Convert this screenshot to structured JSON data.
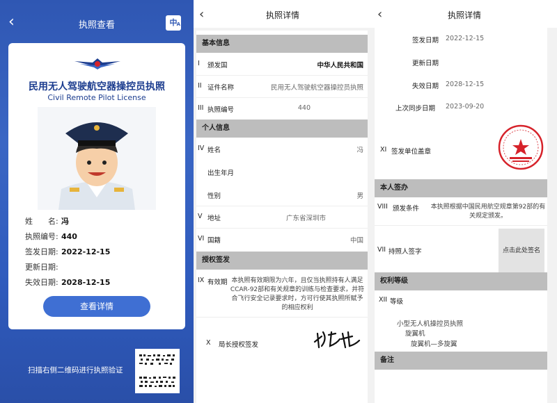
{
  "panel1": {
    "title": "执照查看",
    "lang_badge": "中",
    "lang_sub": "A",
    "license_cn": "民用无人驾驶航空器操控员执照",
    "license_en": "Civil Remote Pilot License",
    "fields": [
      {
        "label": "姓　　名:",
        "value": "冯"
      },
      {
        "label": "执照编号:",
        "value": "440"
      },
      {
        "label": "签发日期:",
        "value": "2022-12-15"
      },
      {
        "label": "更新日期:",
        "value": ""
      },
      {
        "label": "失效日期:",
        "value": "2028-12-15"
      }
    ],
    "button": "查看详情",
    "qr_hint": "扫描右侧二维码进行执照验证"
  },
  "panel2": {
    "title": "执照详情",
    "sec_basic": "基本信息",
    "r1": {
      "num": "I",
      "key": "颁发国",
      "value": "中华人民共和国"
    },
    "r2": {
      "num": "II",
      "key": "证件名称",
      "value": "民用无人驾驶航空器操控员执照"
    },
    "r3": {
      "num": "III",
      "key": "执照编号",
      "value": "440"
    },
    "sec_personal": "个人信息",
    "r4": {
      "num": "IV",
      "key": "姓名",
      "value": "冯"
    },
    "r4a": {
      "key": "出生年月",
      "value": ""
    },
    "r4b": {
      "key": "性别",
      "value": "男"
    },
    "r5": {
      "num": "V",
      "key": "地址",
      "value": "广东省深圳市"
    },
    "r6": {
      "num": "VI",
      "key": "国籍",
      "value": "中国"
    },
    "sec_auth": "授权签发",
    "r9": {
      "num": "IX",
      "key": "有效期",
      "value": "本执照有效期限为六年，且仅当执照持有人满足CCAR-92部和有关规章的训练与检查要求，并符合飞行安全记录要求时，方可行使其执照所赋予的相应权利"
    },
    "r10": {
      "num": "X",
      "key": "局长授权签发"
    }
  },
  "panel3": {
    "title": "执照详情",
    "issue": {
      "key": "签发日期",
      "value": "2022-12-15"
    },
    "update": {
      "key": "更新日期",
      "value": ""
    },
    "expire": {
      "key": "失效日期",
      "value": "2028-12-15"
    },
    "sync": {
      "key": "上次同步日期",
      "value": "2023-09-20"
    },
    "r11": {
      "num": "XI",
      "key": "签发单位盖章"
    },
    "sec_sign": "本人签办",
    "r8": {
      "num": "VIII",
      "key": "颁发条件",
      "value": "本执照根据中国民用航空规章第92部的有关规定颁发。"
    },
    "r7": {
      "num": "VII",
      "key": "持照人签字",
      "value": "点击此处签名"
    },
    "sec_level": "权利等级",
    "r12": {
      "num": "XII",
      "key": "等级"
    },
    "levels": [
      "小型无人机操控员执照",
      "旋翼机",
      "旋翼机—多旋翼"
    ],
    "sec_note": "备注"
  },
  "colors": {
    "primary": "#2f57b3",
    "button": "#3f6fd3",
    "section": "#bdbdbd",
    "seal": "#d6222a"
  }
}
